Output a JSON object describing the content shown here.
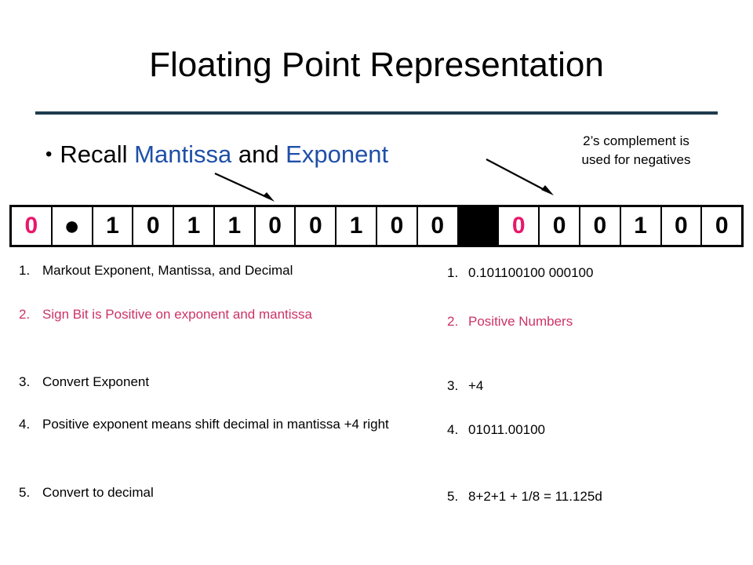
{
  "slide": {
    "title": "Floating Point Representation",
    "divider_color": "#1f3b4d",
    "accent_blue": "#1f4fa8",
    "accent_pink": "#cc3366",
    "bit_pink": "#e8176b"
  },
  "bullet": {
    "marker": "•",
    "prefix": "Recall ",
    "keyword_1": "Mantissa",
    "middle": " and ",
    "keyword_2": "Exponent"
  },
  "note": {
    "line_1": "2’s complement is",
    "line_2": "used for negatives",
    "full": "2’s complement is used for negatives"
  },
  "bit_table": {
    "cells": [
      {
        "value": "0",
        "style": "pink"
      },
      {
        "value": "●",
        "style": "dot"
      },
      {
        "value": "1",
        "style": "normal"
      },
      {
        "value": "0",
        "style": "normal"
      },
      {
        "value": "1",
        "style": "normal"
      },
      {
        "value": "1",
        "style": "normal"
      },
      {
        "value": "0",
        "style": "normal"
      },
      {
        "value": "0",
        "style": "normal"
      },
      {
        "value": "1",
        "style": "normal"
      },
      {
        "value": "0",
        "style": "normal"
      },
      {
        "value": "0",
        "style": "normal"
      },
      {
        "value": "",
        "style": "black"
      },
      {
        "value": "0",
        "style": "pink"
      },
      {
        "value": "0",
        "style": "normal"
      },
      {
        "value": "0",
        "style": "normal"
      },
      {
        "value": "1",
        "style": "normal"
      },
      {
        "value": "0",
        "style": "normal"
      },
      {
        "value": "0",
        "style": "normal"
      }
    ]
  },
  "left_steps": [
    {
      "num": "1.",
      "text": "Markout Exponent, Mantissa, and Decimal",
      "color": "black"
    },
    {
      "num": "2.",
      "text": "Sign Bit is Positive on exponent and mantissa",
      "color": "pink"
    },
    {
      "num": "3.",
      "text": "Convert Exponent",
      "color": "black"
    },
    {
      "num": "4.",
      "text": "Positive exponent means shift decimal in mantissa  +4 right",
      "color": "black"
    },
    {
      "num": "5.",
      "text": "Convert to decimal",
      "color": "black"
    }
  ],
  "right_steps": [
    {
      "num": "1.",
      "text": "0.101100100 000100",
      "color": "black"
    },
    {
      "num": "2.",
      "text": "Positive Numbers",
      "color": "pink"
    },
    {
      "num": "3.",
      "text": "+4",
      "color": "black"
    },
    {
      "num": "4.",
      "text": "01011.00100",
      "color": "black"
    },
    {
      "num": "5.",
      "text": "8+2+1  +  1/8 = 11.125d",
      "color": "black"
    }
  ]
}
